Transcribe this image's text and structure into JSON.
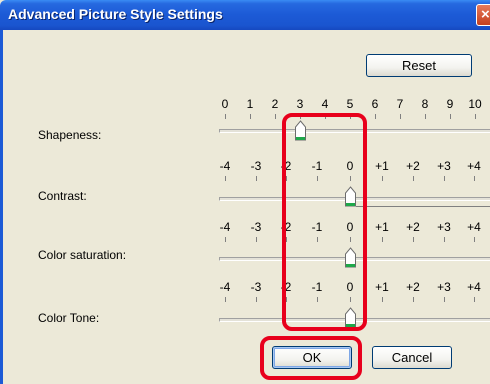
{
  "dialog": {
    "title": "Advanced Picture Style Settings",
    "close_glyph": "×"
  },
  "reset_button": {
    "label": "Reset"
  },
  "scales": {
    "zero_to_ten": [
      "0",
      "1",
      "2",
      "3",
      "4",
      "5",
      "6",
      "7",
      "8",
      "9",
      "10"
    ],
    "minus_to_plus": [
      "-4",
      "-3",
      "-2",
      "-1",
      "0",
      "+1",
      "+2",
      "+3",
      "+4"
    ]
  },
  "settings": [
    {
      "label": "Shapeness:",
      "scale": "0-10",
      "value": 3
    },
    {
      "label": "Contrast:",
      "scale": "-4..+4",
      "value": 0
    },
    {
      "label": "Color saturation:",
      "scale": "-4..+4",
      "value": 0
    },
    {
      "label": "Color Tone:",
      "scale": "-4..+4",
      "value": 0
    }
  ],
  "buttons": {
    "ok": "OK",
    "cancel": "Cancel"
  },
  "colors": {
    "highlight": "#e8001c",
    "titlebar": "#1c5ad6",
    "thumb_fill": "#ffffff",
    "thumb_accent": "#1fa84a"
  }
}
